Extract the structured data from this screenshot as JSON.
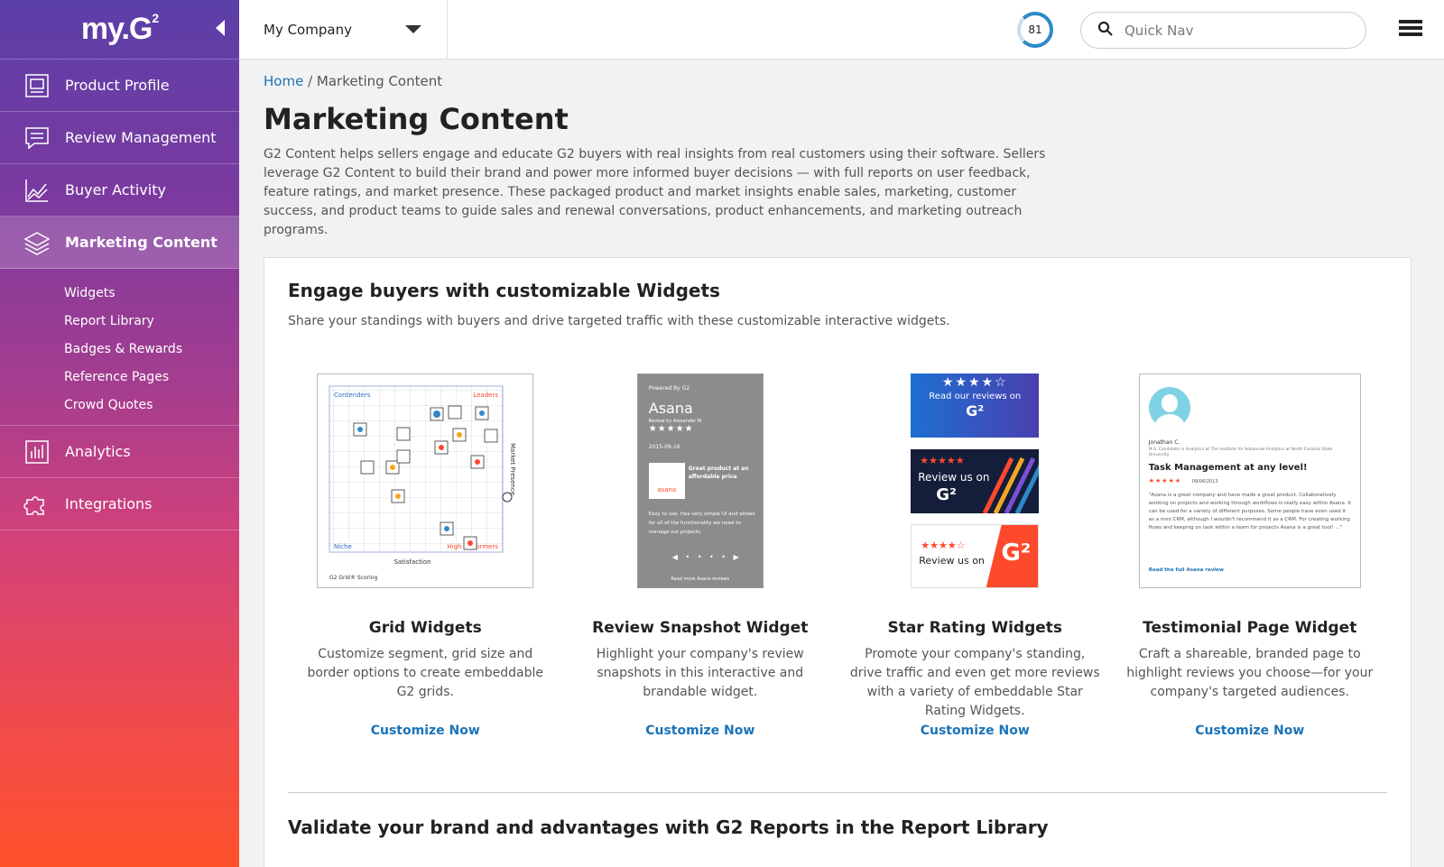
{
  "sidebar": {
    "logo_text": "my.G",
    "logo_sup": "2",
    "items": [
      {
        "label": "Product Profile",
        "icon": "profile-icon"
      },
      {
        "label": "Review Management",
        "icon": "chat-icon"
      },
      {
        "label": "Buyer Activity",
        "icon": "chart-line-icon"
      },
      {
        "label": "Marketing Content",
        "icon": "layers-icon",
        "active": true
      },
      {
        "label": "Analytics",
        "icon": "bar-chart-icon"
      },
      {
        "label": "Integrations",
        "icon": "puzzle-icon"
      }
    ],
    "subitems": [
      "Widgets",
      "Report Library",
      "Badges & Rewards",
      "Reference Pages",
      "Crowd Quotes"
    ]
  },
  "topbar": {
    "company": "My Company",
    "score": "81",
    "search_placeholder": "Quick Nav"
  },
  "breadcrumb": {
    "home": "Home",
    "separator": "/",
    "current": "Marketing Content"
  },
  "page": {
    "title": "Marketing Content",
    "intro": "G2 Content helps sellers engage and educate G2 buyers with real insights from real customers using their software. Sellers leverage G2 Content to build their brand and power more informed buyer decisions — with full reports on user feedback, feature ratings, and market presence. These packaged product and market insights enable sales, marketing, customer success, and product teams to guide sales and renewal conversations, product enhancements, and marketing outreach programs."
  },
  "section_widgets": {
    "title": "Engage buyers with customizable Widgets",
    "subtitle": "Share your standings with buyers and drive targeted traffic with these customizable interactive widgets.",
    "widgets": [
      {
        "title": "Grid Widgets",
        "desc": "Customize segment, grid size and border options to create embeddable G2 grids.",
        "cta": "Customize Now"
      },
      {
        "title": "Review Snapshot Widget",
        "desc": "Highlight your company's review snapshots in this interactive and brandable widget.",
        "cta": "Customize Now"
      },
      {
        "title": "Star Rating Widgets",
        "desc": "Promote your company's standing, drive traffic and even get more reviews with a variety of embeddable Star Rating Widgets.",
        "cta": "Customize Now"
      },
      {
        "title": "Testimonial Page Widget",
        "desc": "Craft a shareable, branded  page to highlight reviews you choose—for  your company's targeted audiences.",
        "cta": "Customize Now"
      }
    ]
  },
  "grid_thumb": {
    "contenders": "Contenders",
    "leaders": "Leaders",
    "niche": "Niche",
    "high_performers": "High Performers",
    "x_axis": "Satisfaction",
    "y_axis": "Market Presence",
    "footer": "G2 Grid® Scoring"
  },
  "snapshot_thumb": {
    "powered": "Powered By G2",
    "product": "Asana",
    "reviewer": "Review by Alexander M.",
    "date": "2015-09-16",
    "headline": "Great product at an affordable price",
    "brand": "asana",
    "body": "Easy to use. Has very simple UI and allows for all of the functionality we need to manage our projects.",
    "footer": "Read more Asana reviews"
  },
  "stars_thumb": {
    "a": "Read our reviews on",
    "b": "Review us on",
    "c": "Review us on"
  },
  "testimonial_thumb": {
    "name": "Jonathan C.",
    "role": "M.S. Candidate in Analytics at The Institute for Advanced Analytics at North Carolina State University",
    "headline": "Task Management at any level!",
    "date": "09/06/2013",
    "body": "\"Asana is a great company and have made a great product. Collaboratively working on projects and working through workflows is really easy within Asana. It can be used for a variety of different purposes. Some people have even used it as a mini CRM, although I wouldn't recommend it as a CRM. For creating working flows and keeping on task within a team for projects Asana is a great tool! ...\"",
    "link": "Read the full Asana review"
  },
  "section_reports": {
    "title": "Validate your brand and advantages with G2 Reports in the Report Library"
  },
  "colors": {
    "accent": "#1a73b8",
    "sidebar_top": "#5b3fa8",
    "sidebar_bottom": "#ff512a",
    "g2_red": "#ff492c"
  }
}
